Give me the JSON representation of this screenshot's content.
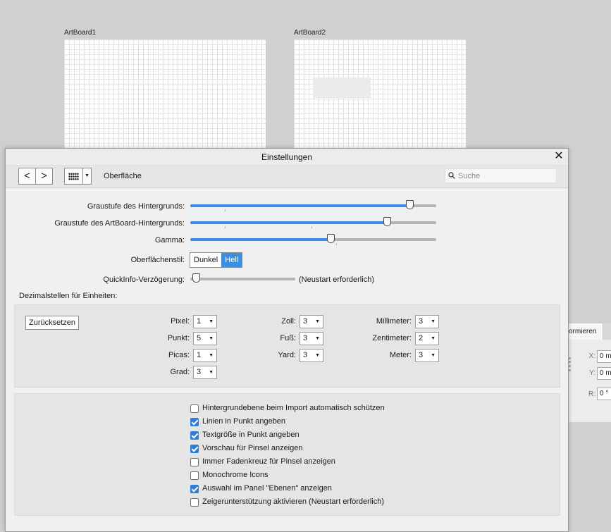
{
  "canvas": {
    "artboards": [
      {
        "label": "ArtBoard1"
      },
      {
        "label": "ArtBoard2"
      }
    ]
  },
  "background_panel": {
    "tab_label": "ormieren",
    "fields": [
      {
        "label": "X:",
        "value": "0 m"
      },
      {
        "label": "Y:",
        "value": "0 m"
      },
      {
        "label": "R:",
        "value": "0 °"
      }
    ]
  },
  "dialog": {
    "title": "Einstellungen",
    "toolbar": {
      "back_glyph": "<",
      "forward_glyph": ">",
      "breadcrumb": "Oberfläche",
      "search_placeholder": "Suche"
    },
    "sliders": [
      {
        "label": "Graustufe des Hintergrunds:",
        "value_fraction": 0.89
      },
      {
        "label": "Graustufe des ArtBoard-Hintergrunds:",
        "value_fraction": 0.8
      },
      {
        "label": "Gamma:",
        "value_fraction": 0.57
      }
    ],
    "surface_style": {
      "label": "Oberflächenstil:",
      "options": [
        "Dunkel",
        "Hell"
      ],
      "selected": "Hell"
    },
    "tooltip_delay": {
      "label": "QuickInfo-Verzögerung:",
      "value_fraction": 0.0,
      "note": "(Neustart erforderlich)"
    },
    "decimals": {
      "title": "Dezimalstellen für Einheiten:",
      "reset_label": "Zurücksetzen",
      "columns": [
        [
          {
            "label": "Pixel:",
            "value": "1"
          },
          {
            "label": "Punkt:",
            "value": "5"
          },
          {
            "label": "Picas:",
            "value": "1"
          },
          {
            "label": "Grad:",
            "value": "3"
          }
        ],
        [
          {
            "label": "Zoll:",
            "value": "3"
          },
          {
            "label": "Fuß:",
            "value": "3"
          },
          {
            "label": "Yard:",
            "value": "3"
          }
        ],
        [
          {
            "label": "Millimeter:",
            "value": "3"
          },
          {
            "label": "Zentimeter:",
            "value": "2"
          },
          {
            "label": "Meter:",
            "value": "3"
          }
        ]
      ]
    },
    "options": [
      {
        "label": "Hintergrundebene beim Import automatisch schützen",
        "checked": false
      },
      {
        "label": "Linien in Punkt angeben",
        "checked": true
      },
      {
        "label": "Textgröße in Punkt angeben",
        "checked": true
      },
      {
        "label": "Vorschau für Pinsel anzeigen",
        "checked": true
      },
      {
        "label": "Immer Fadenkreuz für Pinsel anzeigen",
        "checked": false
      },
      {
        "label": "Monochrome Icons",
        "checked": false
      },
      {
        "label": "Auswahl im Panel \"Ebenen\" anzeigen",
        "checked": true
      },
      {
        "label": "Zeigerunterstützung aktivieren (Neustart erforderlich)",
        "checked": false
      }
    ],
    "colors": {
      "accent": "#3d8ee0",
      "checkbox_on": "#2e7dd7"
    }
  }
}
